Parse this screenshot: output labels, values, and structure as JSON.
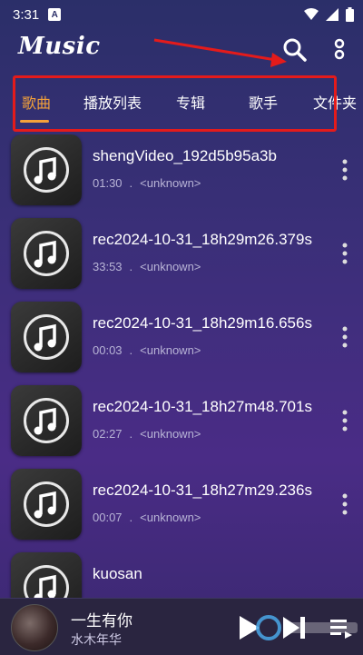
{
  "status_bar": {
    "time": "3:31",
    "notification_letter": "A"
  },
  "app": {
    "logo_text": "Music"
  },
  "tabs": [
    {
      "label": "歌曲",
      "active": true
    },
    {
      "label": "播放列表",
      "active": false
    },
    {
      "label": "专辑",
      "active": false
    },
    {
      "label": "歌手",
      "active": false
    },
    {
      "label": "文件夹",
      "active": false
    }
  ],
  "songs": [
    {
      "title": "shengVideo_192d5b95a3b",
      "duration": "01:30",
      "separator": ".",
      "artist": "<unknown>"
    },
    {
      "title": "rec2024-10-31_18h29m26.379s",
      "duration": "33:53",
      "separator": ".",
      "artist": "<unknown>"
    },
    {
      "title": "rec2024-10-31_18h29m16.656s",
      "duration": "00:03",
      "separator": ".",
      "artist": "<unknown>"
    },
    {
      "title": "rec2024-10-31_18h27m48.701s",
      "duration": "02:27",
      "separator": ".",
      "artist": "<unknown>"
    },
    {
      "title": "rec2024-10-31_18h27m29.236s",
      "duration": "00:07",
      "separator": ".",
      "artist": "<unknown>"
    },
    {
      "title": "kuosan",
      "duration": "",
      "separator": "",
      "artist": ""
    }
  ],
  "now_playing": {
    "title": "一生有你",
    "artist": "水木年华"
  },
  "colors": {
    "accent": "#f4a23a",
    "highlight": "#e41b1b",
    "meta_text": "#b8b4d6"
  },
  "icons": {
    "search": "search-icon",
    "more": "more-vertical-icon",
    "music_note": "music-note-icon",
    "play": "play-icon",
    "next": "skip-next-icon",
    "queue": "queue-icon"
  }
}
